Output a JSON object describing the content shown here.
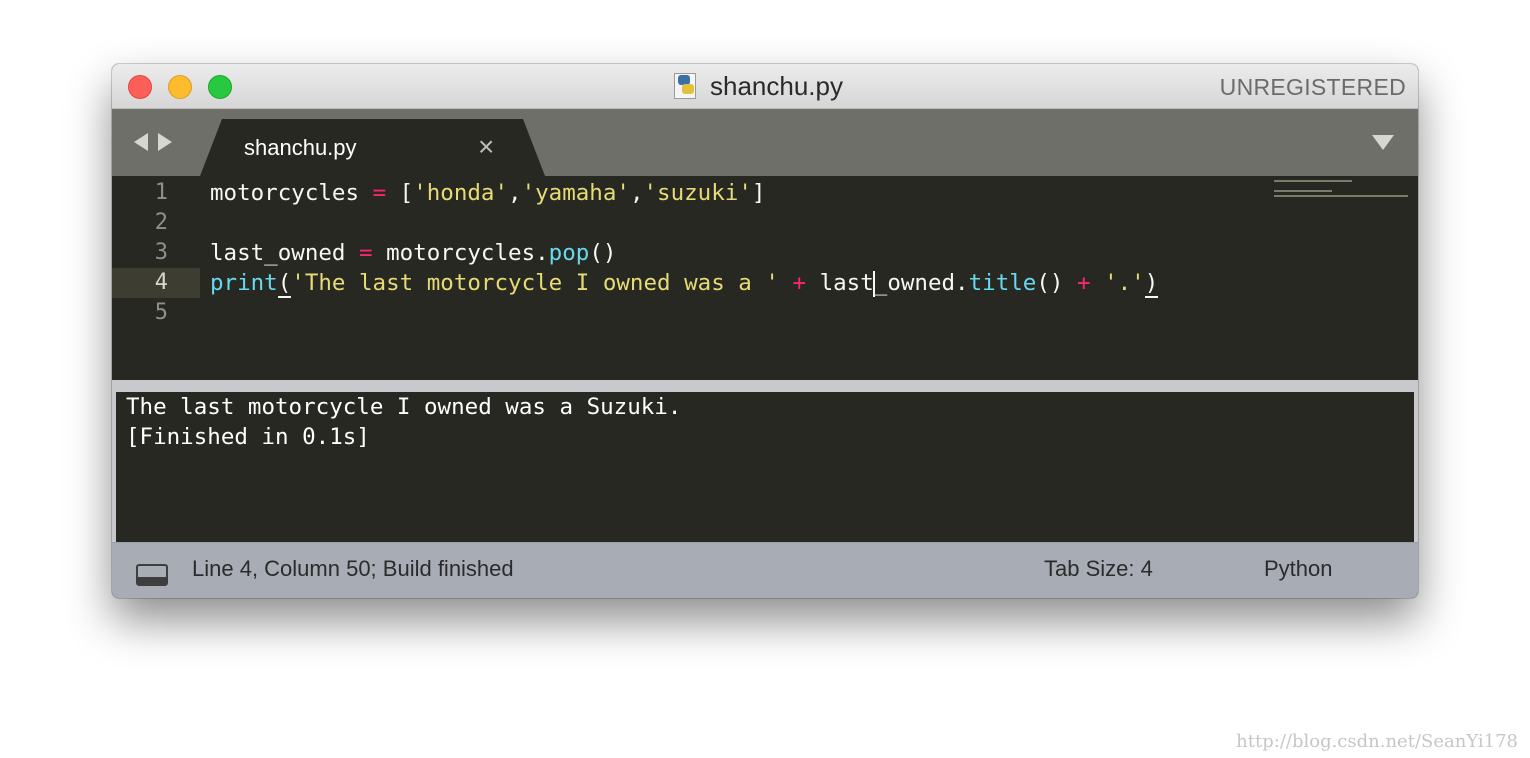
{
  "window": {
    "title": "shanchu.py",
    "license": "UNREGISTERED"
  },
  "tabs": [
    {
      "label": "shanchu.py",
      "close_glyph": "×"
    }
  ],
  "editor": {
    "line_numbers": [
      "1",
      "2",
      "3",
      "4",
      "5"
    ],
    "active_line": 4,
    "lines": {
      "l1": {
        "t1": "motorcycles ",
        "t2": "=",
        "t3": " [",
        "t4": "'honda'",
        "t5": ",",
        "t6": "'yamaha'",
        "t7": ",",
        "t8": "'suzuki'",
        "t9": "]"
      },
      "l3": {
        "t1": "last_owned ",
        "t2": "=",
        "t3": " motorcycles.",
        "t4": "pop",
        "t5": "()"
      },
      "l4": {
        "t1": "print",
        "t2": "(",
        "t3": "'The last motorcycle I owned was a '",
        "t4": " ",
        "t5": "+",
        "t6": " last",
        "t7": "_owned.",
        "t8": "title",
        "t9": "() ",
        "t10": "+",
        "t11": " ",
        "t12": "'.'",
        "t13": ")"
      }
    }
  },
  "output": {
    "lines": [
      "The last motorcycle I owned was a Suzuki.",
      "[Finished in 0.1s]"
    ]
  },
  "status": {
    "position": "Line 4, Column 50; Build finished",
    "tab_size": "Tab Size: 4",
    "syntax": "Python"
  },
  "watermark": "http://blog.csdn.net/SeanYi178",
  "icons": {
    "file": "python-file-icon",
    "panel": "panel-toggle-icon"
  },
  "colors": {
    "background": "#272822",
    "string": "#e6db74",
    "operator": "#f92672",
    "function": "#66d9ef",
    "text": "#f8f8f2"
  }
}
